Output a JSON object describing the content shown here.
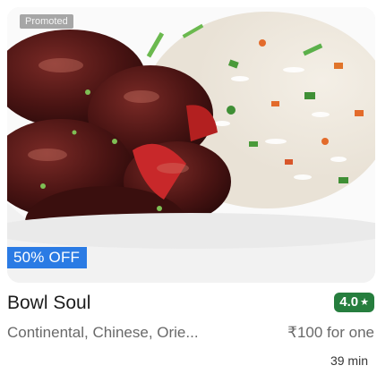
{
  "card": {
    "promoted_label": "Promoted",
    "offer_label": "50% OFF",
    "name": "Bowl Soul",
    "rating": "4.0",
    "rating_icon": "star-icon",
    "cuisines": "Continental, Chinese, Orie...",
    "price": "₹100 for one",
    "delivery_time": "39 min",
    "image_subject": "food-photo",
    "colors": {
      "offer_bg": "#2b7be4",
      "rating_bg": "#267e3e",
      "title_text": "#1c1c1c",
      "secondary_text": "#696969"
    }
  }
}
